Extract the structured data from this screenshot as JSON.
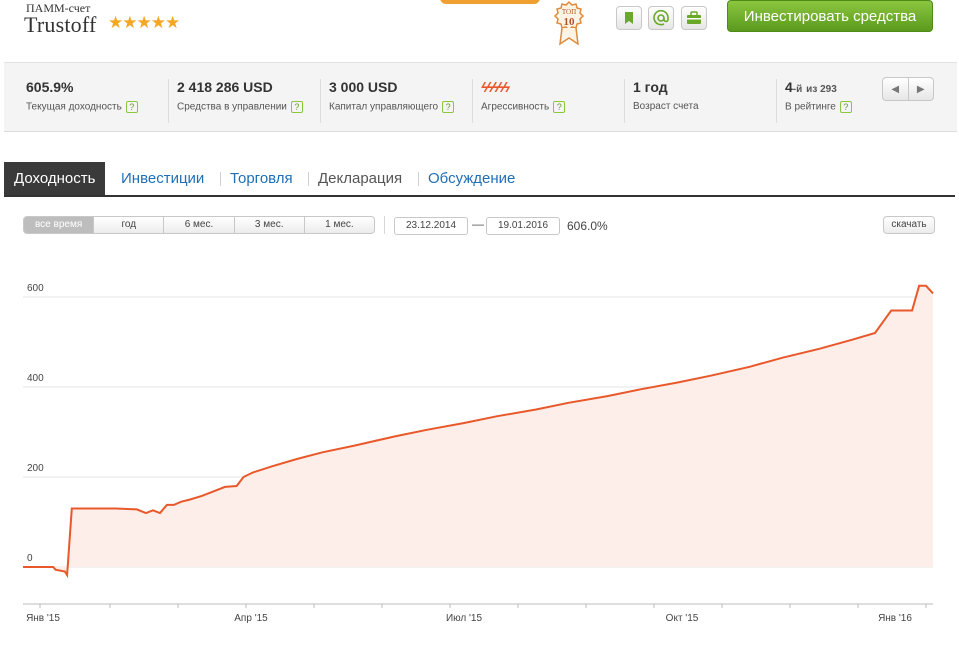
{
  "header": {
    "account_type": "ПАММ-счет",
    "account_name": "Trustoff",
    "stars": "★★★★★",
    "badge_line1": "ТОП",
    "badge_line2": "10",
    "invest_button": "Инвестировать средства",
    "icons": [
      "bookmark-icon",
      "at-icon",
      "briefcase-icon"
    ]
  },
  "stats": [
    {
      "value": "605.9%",
      "label": "Текущая доходность"
    },
    {
      "value": "2 418 286 USD",
      "label": "Средства в управлении"
    },
    {
      "value": "3 000 USD",
      "label": "Капитал управляющего"
    },
    {
      "value": "ϟϟϟϟϟ",
      "label": "Агрессивность"
    },
    {
      "value": "1 год",
      "label": "Возраст счета"
    }
  ],
  "rank": {
    "number": "4",
    "suffix": "-й",
    "of_text": "из 293",
    "label": "В рейтинге"
  },
  "help_mark": "?",
  "pager": {
    "prev": "◀",
    "next": "▶"
  },
  "tabs": [
    {
      "label": "Доходность",
      "active": true
    },
    {
      "label": "Инвестиции"
    },
    {
      "label": "Торговля"
    },
    {
      "label": "Декларация"
    },
    {
      "label": "Обсуждение"
    }
  ],
  "ranges": [
    "все время",
    "год",
    "6 мес.",
    "3 мес.",
    "1 мес."
  ],
  "active_range": "все время",
  "date_from": "23.12.2014",
  "date_to": "19.01.2016",
  "date_dash": "—",
  "period_return": "606.0%",
  "download_label": "скачать",
  "colors": {
    "line": "#e8582a",
    "fill": "#fdeee9",
    "accent_green": "#6aa82a",
    "brand_orange": "#f0a030"
  },
  "chart_data": {
    "type": "area",
    "title": "",
    "xlabel": "",
    "ylabel": "",
    "x_ticks": [
      "Янв '15",
      "Апр '15",
      "Июл '15",
      "Окт '15",
      "Янв '16"
    ],
    "y_ticks": [
      "0",
      "200",
      "400",
      "600"
    ],
    "ylim": [
      -30,
      650
    ],
    "grid": true,
    "series": [
      {
        "x": [
          "2014-12-23",
          "2015-01-05",
          "2015-01-06",
          "2015-01-10",
          "2015-01-11",
          "2015-01-13",
          "2015-01-14",
          "2015-02-01",
          "2015-02-10",
          "2015-02-14",
          "2015-02-17",
          "2015-02-20",
          "2015-02-23",
          "2015-02-26",
          "2015-03-01",
          "2015-03-05",
          "2015-03-10",
          "2015-03-15",
          "2015-03-20",
          "2015-03-25",
          "2015-03-28",
          "2015-04-01",
          "2015-04-10",
          "2015-04-20",
          "2015-05-01",
          "2015-05-15",
          "2015-06-01",
          "2015-06-15",
          "2015-07-01",
          "2015-07-15",
          "2015-08-01",
          "2015-08-15",
          "2015-09-01",
          "2015-09-15",
          "2015-10-01",
          "2015-10-15",
          "2015-11-01",
          "2015-11-15",
          "2015-12-01",
          "2015-12-15",
          "2015-12-25",
          "2016-01-01",
          "2016-01-10",
          "2016-01-13",
          "2016-01-16",
          "2016-01-19"
        ],
        "y": [
          0,
          0,
          -6,
          -10,
          -18,
          130,
          130,
          130,
          128,
          120,
          126,
          120,
          138,
          138,
          145,
          150,
          158,
          168,
          178,
          180,
          200,
          210,
          225,
          240,
          255,
          270,
          290,
          305,
          320,
          335,
          350,
          365,
          380,
          395,
          410,
          425,
          445,
          465,
          485,
          505,
          520,
          570,
          570,
          625,
          625,
          608
        ]
      }
    ]
  }
}
